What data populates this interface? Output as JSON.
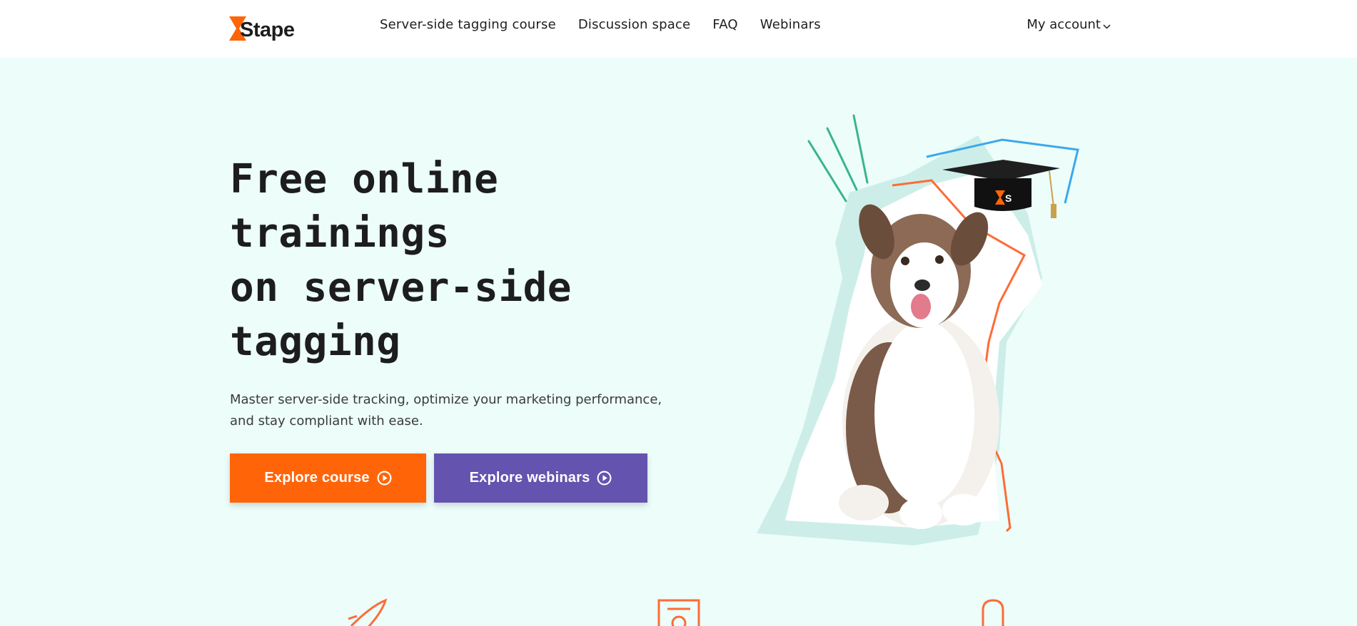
{
  "header": {
    "logo_text": "Stape",
    "nav": [
      {
        "label": "Server-side tagging course"
      },
      {
        "label": "Discussion space"
      },
      {
        "label": "FAQ"
      },
      {
        "label": "Webinars"
      }
    ],
    "account_label": "My account"
  },
  "hero": {
    "title_lines": [
      "Free online",
      "trainings",
      "on server-side",
      "tagging"
    ],
    "subtitle_lines": [
      "Master server-side tracking, optimize your marketing performance,",
      "and stay compliant with ease."
    ],
    "buttons": {
      "course": "Explore course",
      "webinars": "Explore webinars"
    },
    "cap_badge": "S"
  },
  "colors": {
    "background": "#ecfdfa",
    "header": "#ffffff",
    "brand_orange": "#ff6508",
    "brand_purple": "#6454b0",
    "accent_teal": "#3bb38e",
    "accent_blue": "#3aa8ee",
    "mint_shape": "#cdeee8"
  },
  "icons": {
    "hero_art": "dog-with-graduation-cap-illustration",
    "features": [
      "rocket-icon",
      "certificate-icon",
      "lightbulb-icon"
    ]
  }
}
